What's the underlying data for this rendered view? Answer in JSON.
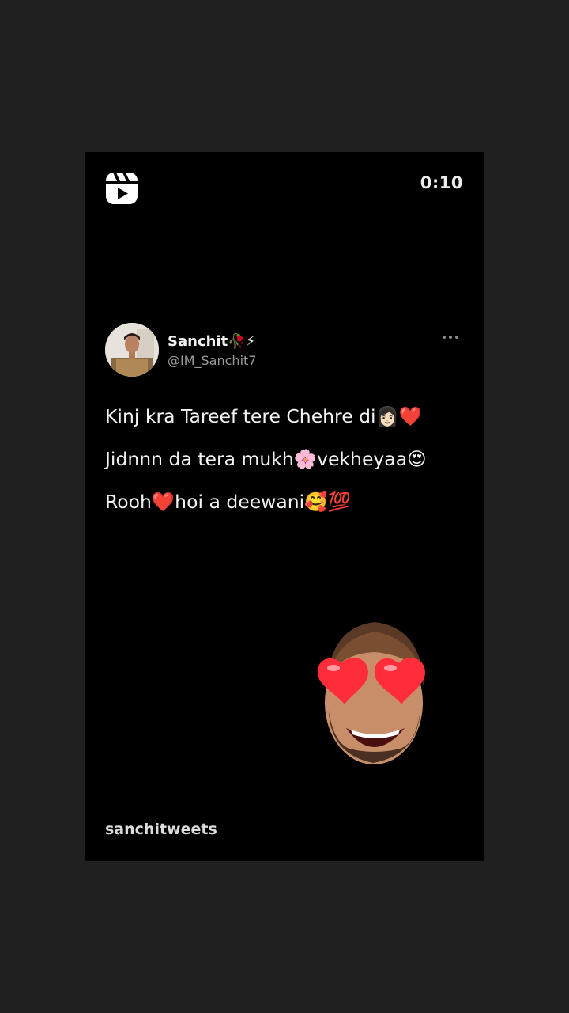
{
  "reel": {
    "timer": "0:10",
    "account": "sanchitweets"
  },
  "tweet": {
    "display_name": "Sanchit🥀⚡",
    "handle": "@IM_Sanchit7",
    "line1": "Kinj kra Tareef tere Chehre di👩🏻❤️",
    "line2": "Jidnnn da tera mukh🌸vekheyaa😍",
    "line3": "Rooh❤️hoi a deewani🥰💯"
  },
  "icons": {
    "reels": "instagram-reels-icon",
    "more": "more-options-icon"
  },
  "colors": {
    "background": "#202020",
    "card": "#000000",
    "text": "#f3f3f3",
    "handle": "#9a9a9a"
  }
}
